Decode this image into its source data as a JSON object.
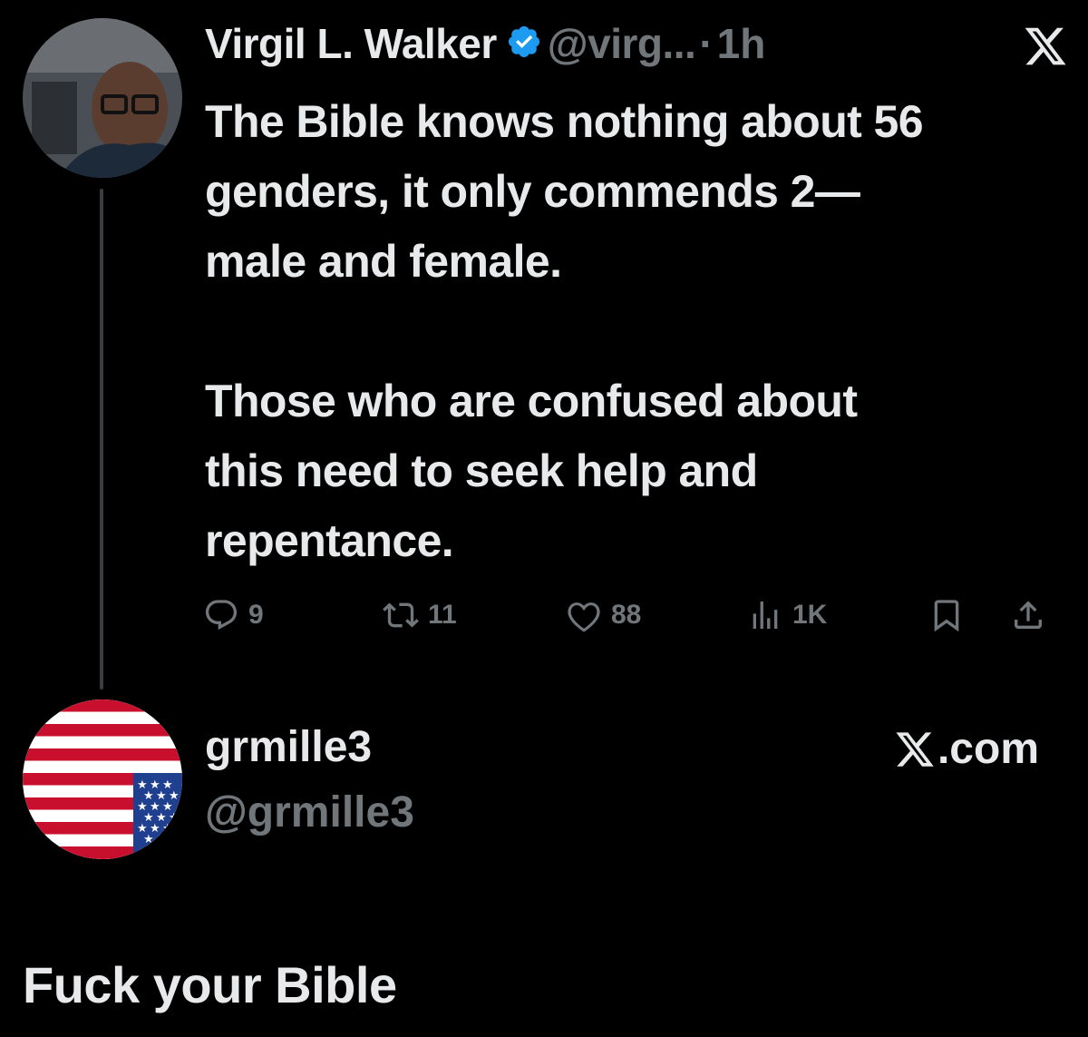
{
  "tweet": {
    "author_name": "Virgil L. Walker",
    "handle": "@virg...",
    "separator": "·",
    "time": "1h",
    "verified_icon": "verified-badge-icon",
    "close_icon": "x-logo-icon",
    "lines": [
      "The Bible knows nothing about 56",
      "genders, it only commends 2—",
      "male and female.",
      "",
      "Those who are confused about",
      "this need to seek help and",
      "repentance."
    ],
    "actions": {
      "reply_count": "9",
      "retweet_count": "11",
      "like_count": "88",
      "views_count": "1K"
    }
  },
  "reply": {
    "name": "grmille3",
    "handle": "@grmille3",
    "brand": ".com",
    "text": "Fuck your Bible"
  },
  "colors": {
    "background": "#000000",
    "text": "#e7e9ea",
    "muted": "#71767b",
    "verified": "#1d9bf0"
  }
}
